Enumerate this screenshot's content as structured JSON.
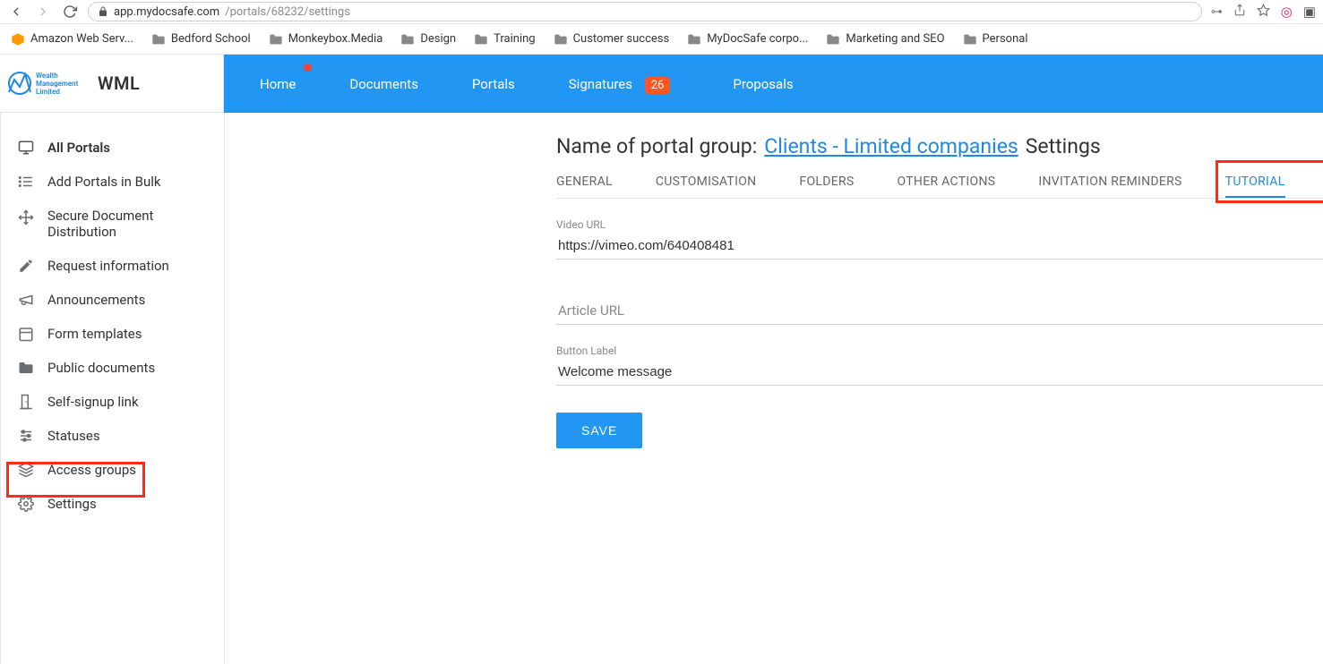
{
  "browser": {
    "url_host": "app.mydocsafe.com",
    "url_path": "/portals/68232/settings",
    "bookmarks": [
      "Amazon Web Serv...",
      "Bedford School",
      "Monkeybox.Media",
      "Design",
      "Training",
      "Customer success",
      "MyDocSafe corpo...",
      "Marketing and SEO",
      "Personal"
    ]
  },
  "brand": {
    "short": "WML",
    "logo_line1": "Wealth",
    "logo_line2": "Management",
    "logo_line3": "Limited"
  },
  "topnav": {
    "items": [
      "Home",
      "Documents",
      "Portals",
      "Signatures",
      "Proposals"
    ],
    "signatures_badge": "26"
  },
  "sidebar": {
    "header": "All Portals",
    "items": [
      "Add Portals in Bulk",
      "Secure Document Distribution",
      "Request information",
      "Announcements",
      "Form templates",
      "Public documents",
      "Self-signup link",
      "Statuses",
      "Access groups",
      "Settings"
    ]
  },
  "page": {
    "title_prefix": "Name of portal group:",
    "group_link": "Clients - Limited companies",
    "title_suffix": "Settings",
    "tabs": [
      "GENERAL",
      "CUSTOMISATION",
      "FOLDERS",
      "OTHER ACTIONS",
      "INVITATION REMINDERS",
      "TUTORIAL"
    ],
    "active_tab": "TUTORIAL",
    "fields": {
      "video_url_label": "Video URL",
      "video_url_value": "https://vimeo.com/640408481",
      "article_url_label": "Article URL",
      "article_url_value": "",
      "button_label_label": "Button Label",
      "button_label_value": "Welcome message"
    },
    "save_label": "SAVE"
  }
}
